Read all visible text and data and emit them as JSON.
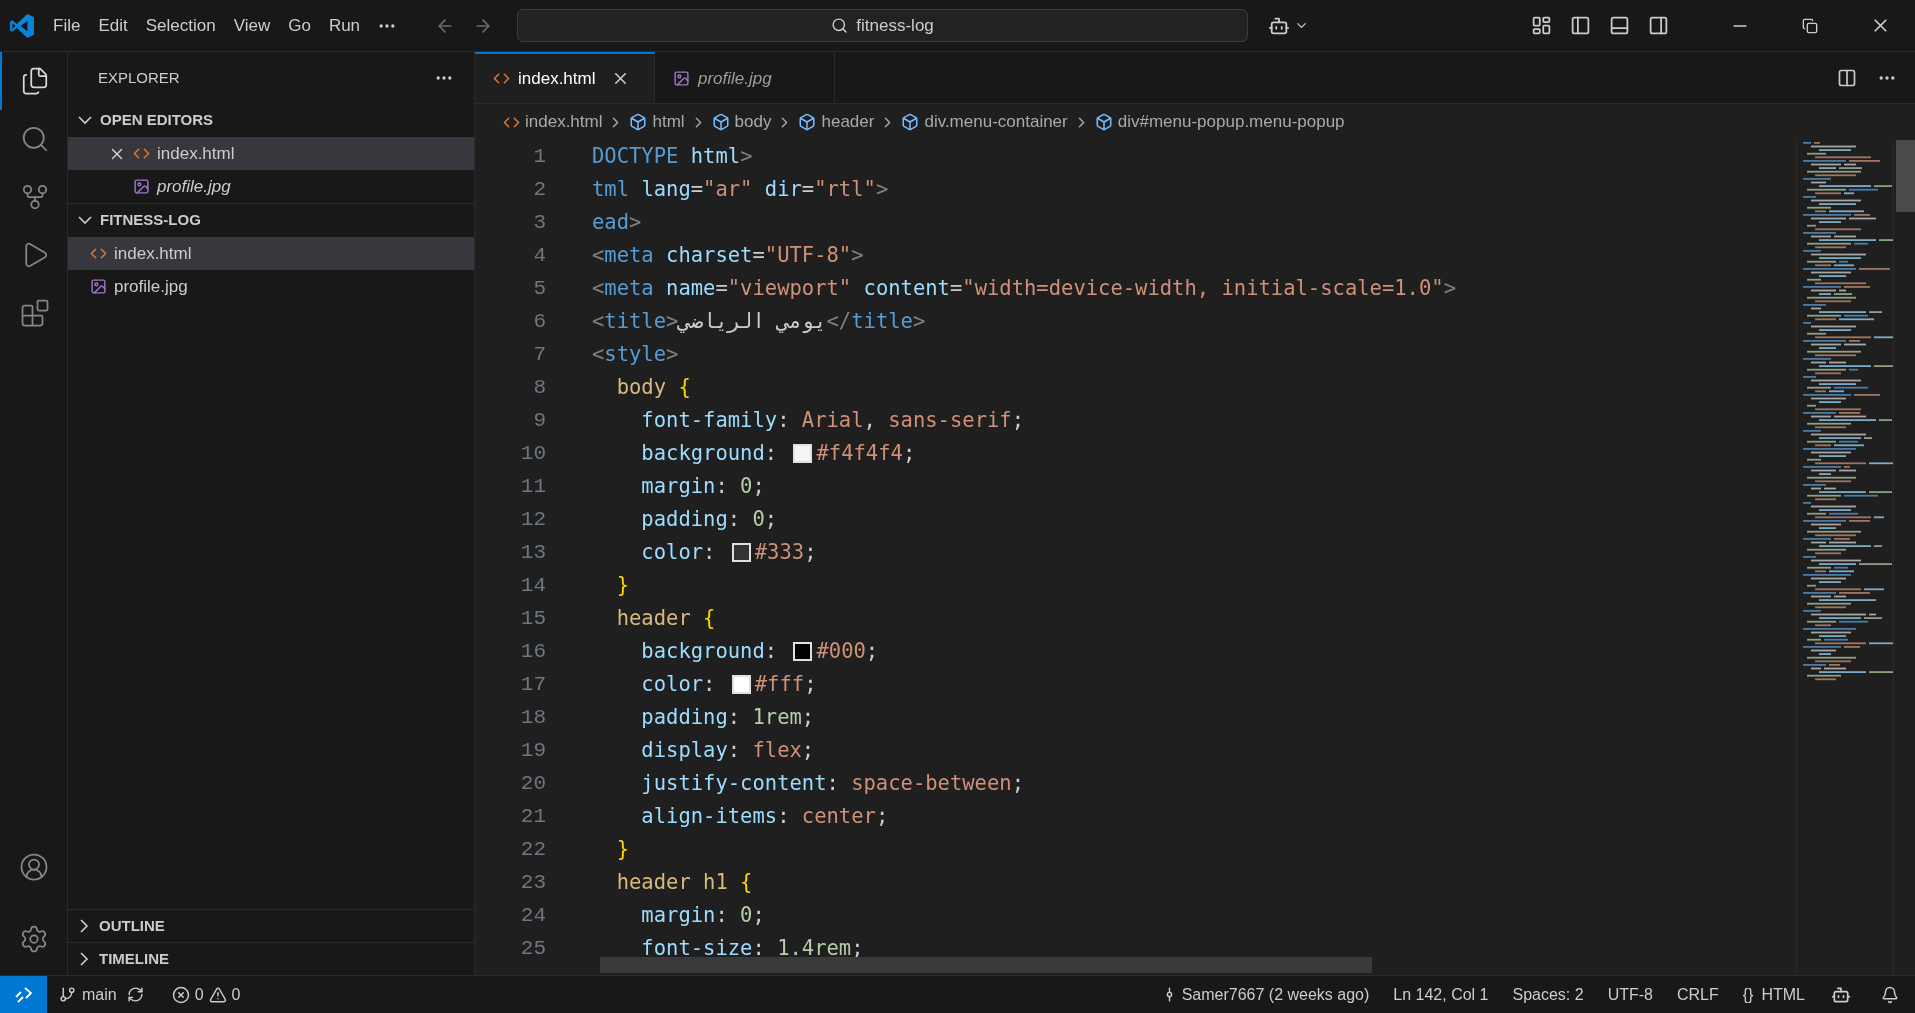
{
  "menu": [
    {
      "label": "File"
    },
    {
      "label": "Edit"
    },
    {
      "label": "Selection"
    },
    {
      "label": "View"
    },
    {
      "label": "Go"
    },
    {
      "label": "Run"
    }
  ],
  "command_center": {
    "text": "fitness-log"
  },
  "activity_bar": [
    {
      "kind": "files",
      "selected": true
    },
    {
      "kind": "search",
      "selected": false
    },
    {
      "kind": "source-control",
      "selected": false
    },
    {
      "kind": "run",
      "selected": false
    },
    {
      "kind": "extensions",
      "selected": false
    }
  ],
  "sidebar": {
    "title": "EXPLORER",
    "sections": [
      {
        "title": "OPEN EDITORS",
        "expanded": true,
        "items": [
          {
            "name": "index.html",
            "kind": "html",
            "selected": true,
            "close_button": true,
            "preview": false
          },
          {
            "name": "profile.jpg",
            "kind": "image",
            "selected": false,
            "close_button": false,
            "preview": true
          }
        ]
      },
      {
        "title": "FITNESS-LOG",
        "expanded": true,
        "items": [
          {
            "name": "index.html",
            "kind": "html",
            "selected": true,
            "close_button": false,
            "preview": false
          },
          {
            "name": "profile.jpg",
            "kind": "image",
            "selected": false,
            "close_button": false,
            "preview": false
          }
        ]
      }
    ],
    "bottom_sections": [
      {
        "title": "OUTLINE",
        "expanded": false
      },
      {
        "title": "TIMELINE",
        "expanded": false
      }
    ]
  },
  "tabs": [
    {
      "label": "index.html",
      "kind": "html",
      "selected": true,
      "preview": false
    },
    {
      "label": "profile.jpg",
      "kind": "image",
      "selected": false,
      "preview": true
    }
  ],
  "breadcrumbs": [
    {
      "label": "index.html",
      "kind": "file"
    },
    {
      "label": "html",
      "kind": "element"
    },
    {
      "label": "body",
      "kind": "element"
    },
    {
      "label": "header",
      "kind": "element"
    },
    {
      "label": "div.menu-container",
      "kind": "element"
    },
    {
      "label": "div#menu-popup.menu-popup",
      "kind": "element"
    }
  ],
  "code_lines": [
    {
      "number": "1",
      "tokens": [
        {
          "kind": "tag",
          "text": "DOCTYPE "
        },
        {
          "kind": "attr",
          "text": "html"
        },
        {
          "kind": "punct",
          "text": ">"
        }
      ]
    },
    {
      "number": "2",
      "tokens": [
        {
          "kind": "tag",
          "text": "tml "
        },
        {
          "kind": "attr",
          "text": "lang"
        },
        {
          "kind": "text",
          "text": "="
        },
        {
          "kind": "str",
          "text": "\"ar\" "
        },
        {
          "kind": "attr",
          "text": "dir"
        },
        {
          "kind": "text",
          "text": "="
        },
        {
          "kind": "str",
          "text": "\"rtl\""
        },
        {
          "kind": "punct",
          "text": ">"
        }
      ]
    },
    {
      "number": "3",
      "tokens": [
        {
          "kind": "tag",
          "text": "ead"
        },
        {
          "kind": "punct",
          "text": ">"
        }
      ]
    },
    {
      "number": "4",
      "tokens": [
        {
          "kind": "punct",
          "text": "<"
        },
        {
          "kind": "tag",
          "text": "meta "
        },
        {
          "kind": "attr",
          "text": "charset"
        },
        {
          "kind": "text",
          "text": "="
        },
        {
          "kind": "str",
          "text": "\"UTF-8\""
        },
        {
          "kind": "punct",
          "text": ">"
        }
      ]
    },
    {
      "number": "5",
      "tokens": [
        {
          "kind": "punct",
          "text": "<"
        },
        {
          "kind": "tag",
          "text": "meta "
        },
        {
          "kind": "attr",
          "text": "name"
        },
        {
          "kind": "text",
          "text": "="
        },
        {
          "kind": "str",
          "text": "\"viewport\" "
        },
        {
          "kind": "attr",
          "text": "content"
        },
        {
          "kind": "text",
          "text": "="
        },
        {
          "kind": "str",
          "text": "\"width=device-width, initial-scale=1.0\""
        },
        {
          "kind": "punct",
          "text": ">"
        }
      ]
    },
    {
      "number": "6",
      "tokens": [
        {
          "kind": "punct",
          "text": "<"
        },
        {
          "kind": "tag",
          "text": "title"
        },
        {
          "kind": "punct",
          "text": ">"
        },
        {
          "kind": "text",
          "text": "يومي الرياضي"
        },
        {
          "kind": "punct",
          "text": "</"
        },
        {
          "kind": "tag",
          "text": "title"
        },
        {
          "kind": "punct",
          "text": ">"
        }
      ]
    },
    {
      "number": "7",
      "tokens": [
        {
          "kind": "punct",
          "text": "<"
        },
        {
          "kind": "tag",
          "text": "style"
        },
        {
          "kind": "punct",
          "text": ">"
        }
      ]
    },
    {
      "number": "8",
      "tokens": [
        {
          "kind": "selector",
          "text": "  body "
        },
        {
          "kind": "brace",
          "text": "{"
        }
      ]
    },
    {
      "number": "9",
      "tokens": [
        {
          "kind": "prop",
          "text": "    font-family"
        },
        {
          "kind": "text",
          "text": ": "
        },
        {
          "kind": "value",
          "text": "Arial"
        },
        {
          "kind": "text",
          "text": ", "
        },
        {
          "kind": "value",
          "text": "sans-serif"
        },
        {
          "kind": "text",
          "text": ";"
        }
      ]
    },
    {
      "number": "10",
      "tokens": [
        {
          "kind": "prop",
          "text": "    background"
        },
        {
          "kind": "text",
          "text": ": "
        },
        {
          "kind": "swatch",
          "color": "#f4f4f4"
        },
        {
          "kind": "value",
          "text": "#f4f4f4"
        },
        {
          "kind": "text",
          "text": ";"
        }
      ]
    },
    {
      "number": "11",
      "tokens": [
        {
          "kind": "prop",
          "text": "    margin"
        },
        {
          "kind": "text",
          "text": ": "
        },
        {
          "kind": "num",
          "text": "0"
        },
        {
          "kind": "text",
          "text": ";"
        }
      ]
    },
    {
      "number": "12",
      "tokens": [
        {
          "kind": "prop",
          "text": "    padding"
        },
        {
          "kind": "text",
          "text": ": "
        },
        {
          "kind": "num",
          "text": "0"
        },
        {
          "kind": "text",
          "text": ";"
        }
      ]
    },
    {
      "number": "13",
      "tokens": [
        {
          "kind": "prop",
          "text": "    color"
        },
        {
          "kind": "text",
          "text": ": "
        },
        {
          "kind": "swatch",
          "color": "#333333"
        },
        {
          "kind": "value",
          "text": "#333"
        },
        {
          "kind": "text",
          "text": ";"
        }
      ]
    },
    {
      "number": "14",
      "tokens": [
        {
          "kind": "brace",
          "text": "  }"
        }
      ]
    },
    {
      "number": "15",
      "tokens": [
        {
          "kind": "selector",
          "text": "  header "
        },
        {
          "kind": "brace",
          "text": "{"
        }
      ]
    },
    {
      "number": "16",
      "tokens": [
        {
          "kind": "prop",
          "text": "    background"
        },
        {
          "kind": "text",
          "text": ": "
        },
        {
          "kind": "swatch",
          "color": "#000000"
        },
        {
          "kind": "value",
          "text": "#000"
        },
        {
          "kind": "text",
          "text": ";"
        }
      ]
    },
    {
      "number": "17",
      "tokens": [
        {
          "kind": "prop",
          "text": "    color"
        },
        {
          "kind": "text",
          "text": ": "
        },
        {
          "kind": "swatch",
          "color": "#ffffff"
        },
        {
          "kind": "value",
          "text": "#fff"
        },
        {
          "kind": "text",
          "text": ";"
        }
      ]
    },
    {
      "number": "18",
      "tokens": [
        {
          "kind": "prop",
          "text": "    padding"
        },
        {
          "kind": "text",
          "text": ": "
        },
        {
          "kind": "num",
          "text": "1rem"
        },
        {
          "kind": "text",
          "text": ";"
        }
      ]
    },
    {
      "number": "19",
      "tokens": [
        {
          "kind": "prop",
          "text": "    display"
        },
        {
          "kind": "text",
          "text": ": "
        },
        {
          "kind": "value",
          "text": "flex"
        },
        {
          "kind": "text",
          "text": ";"
        }
      ]
    },
    {
      "number": "20",
      "tokens": [
        {
          "kind": "prop",
          "text": "    justify-content"
        },
        {
          "kind": "text",
          "text": ": "
        },
        {
          "kind": "value",
          "text": "space-between"
        },
        {
          "kind": "text",
          "text": ";"
        }
      ]
    },
    {
      "number": "21",
      "tokens": [
        {
          "kind": "prop",
          "text": "    align-items"
        },
        {
          "kind": "text",
          "text": ": "
        },
        {
          "kind": "value",
          "text": "center"
        },
        {
          "kind": "text",
          "text": ";"
        }
      ]
    },
    {
      "number": "22",
      "tokens": [
        {
          "kind": "brace",
          "text": "  }"
        }
      ]
    },
    {
      "number": "23",
      "tokens": [
        {
          "kind": "selector",
          "text": "  header h1 "
        },
        {
          "kind": "brace",
          "text": "{"
        }
      ]
    },
    {
      "number": "24",
      "tokens": [
        {
          "kind": "prop",
          "text": "    margin"
        },
        {
          "kind": "text",
          "text": ": "
        },
        {
          "kind": "num",
          "text": "0"
        },
        {
          "kind": "text",
          "text": ";"
        }
      ]
    },
    {
      "number": "25",
      "tokens": [
        {
          "kind": "prop",
          "text": "    font-size"
        },
        {
          "kind": "text",
          "text": ": "
        },
        {
          "kind": "num",
          "text": "1.4rem"
        },
        {
          "kind": "text",
          "text": ";"
        }
      ]
    }
  ],
  "status_bar": {
    "branch": "main",
    "errors": "0",
    "warnings": "0",
    "right": [
      {
        "kind": "blame",
        "text": "Samer7667 (2 weeks ago)"
      },
      {
        "kind": "text",
        "text": "Ln 142, Col 1"
      },
      {
        "kind": "text",
        "text": "Spaces: 2"
      },
      {
        "kind": "text",
        "text": "UTF-8"
      },
      {
        "kind": "text",
        "text": "CRLF"
      },
      {
        "kind": "language",
        "prefix": "{}",
        "text": "HTML"
      },
      {
        "kind": "copilot"
      },
      {
        "kind": "bell"
      }
    ]
  }
}
